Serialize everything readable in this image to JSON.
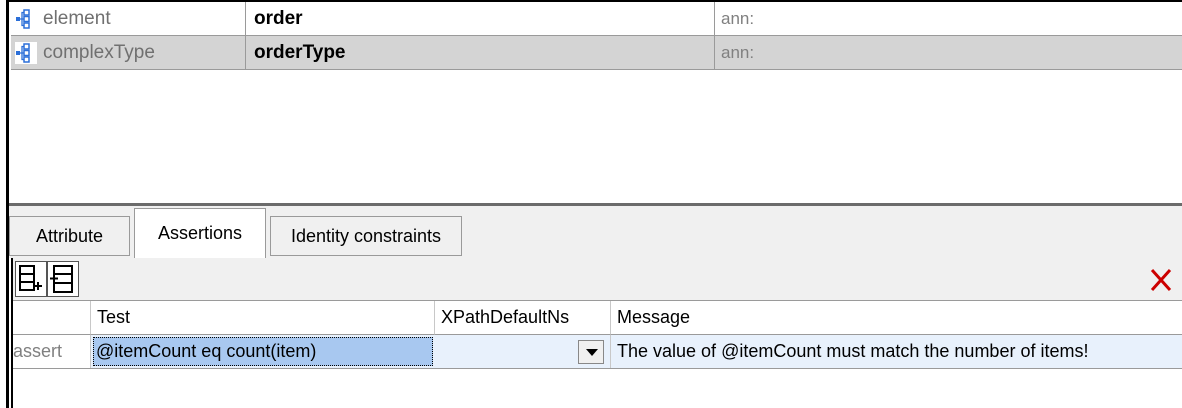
{
  "components": [
    {
      "kind": "element",
      "name": "order",
      "ann": "ann:"
    },
    {
      "kind": "complexType",
      "name": "orderType",
      "ann": "ann:"
    }
  ],
  "tabs": [
    {
      "label": "Attribute"
    },
    {
      "label": "Assertions"
    },
    {
      "label": "Identity constraints"
    }
  ],
  "table": {
    "headers": {
      "test": "Test",
      "xpath": "XPathDefaultNs",
      "message": "Message"
    },
    "rows": [
      {
        "type": "assert",
        "test": "@itemCount eq count(item)",
        "xpath": "",
        "message": "The value of @itemCount must match the number of items!"
      }
    ]
  },
  "colors": {
    "selected_row": "#d4d4d4",
    "selected_cell": "#a8c8f0",
    "row_bg": "#e8f1fc",
    "delete": "#cc0000"
  }
}
